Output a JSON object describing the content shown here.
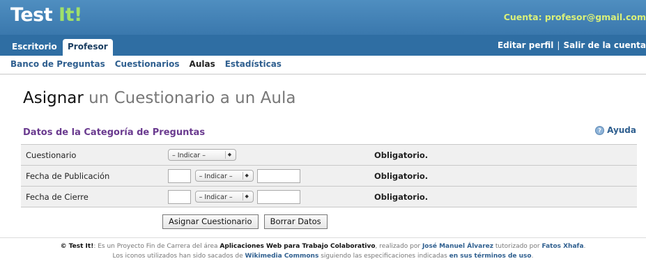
{
  "header": {
    "logo_main": "Test",
    "logo_accent": "It!",
    "account_label": "Cuenta: profesor@gmail.com"
  },
  "tabs": {
    "inactive": "Escritorio",
    "active": "Profesor"
  },
  "user_links": {
    "edit_profile": "Editar perfil",
    "separator": "|",
    "logout": "Salir de la cuenta"
  },
  "subnav": {
    "items": [
      "Banco de Preguntas",
      "Cuestionarios",
      "Aulas",
      "Estadísticas"
    ]
  },
  "page": {
    "title_strong": "Asignar",
    "title_rest": "un Cuestionario a un Aula",
    "section_title": "Datos de la Categoría de Preguntas",
    "help": "Ayuda",
    "help_icon": "help-icon"
  },
  "form": {
    "rows": [
      {
        "label": "Cuestionario",
        "select": "– Indicar –",
        "required": "Obligatorio."
      },
      {
        "label": "Fecha de Publicación",
        "day": "",
        "select": "– Indicar –",
        "year": "",
        "required": "Obligatorio."
      },
      {
        "label": "Fecha de Cierre",
        "day": "",
        "select": "– Indicar –",
        "year": "",
        "required": "Obligatorio."
      }
    ],
    "submit": "Asignar Cuestionario",
    "reset": "Borrar Datos"
  },
  "footer": {
    "brand": "© Test It!",
    "text1": ": Es un Proyecto Fin de Carrera del área ",
    "area": "Aplicaciones Web para Trabajo Colaborativo",
    "text2": ", realizado por ",
    "author": "José Manuel Álvarez",
    "text3": " tutorizado por ",
    "tutor": "Fatos Xhafa",
    "text4": ".",
    "line2_a": "Los iconos utilizados han sido sacados de ",
    "wikimedia": "Wikimedia Commons",
    "line2_b": " siguiendo las especificaciones indicadas ",
    "terms": "en sus términos de uso",
    "line2_c": "."
  },
  "colors": {
    "header_bg": "#3f80b6",
    "tabs_bg": "#2f6ea3",
    "accent_green": "#9fe06a",
    "section_purple": "#6a3a8f",
    "link_blue": "#2f5f8f"
  }
}
